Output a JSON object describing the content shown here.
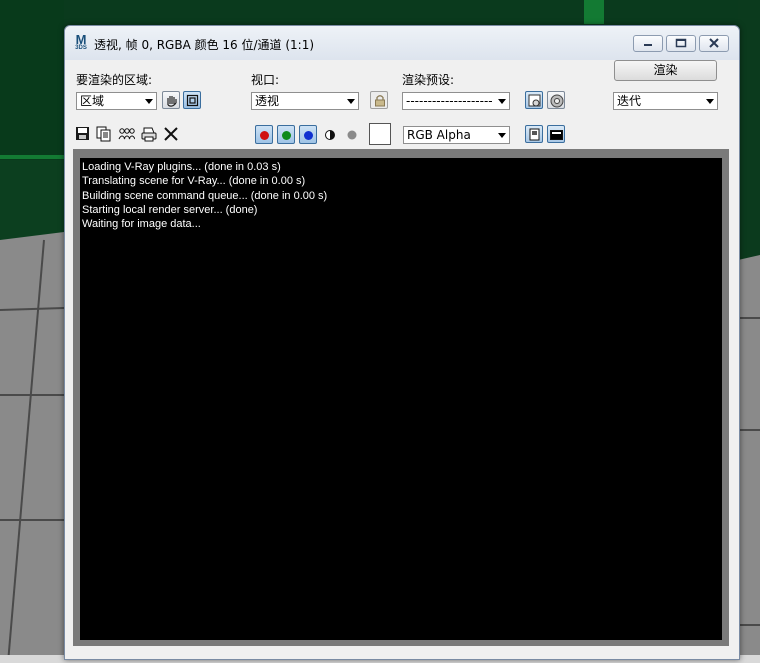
{
  "window": {
    "title": "透视, 帧 0, RGBA 颜色 16 位/通道 (1:1)",
    "logo_text": "M",
    "logo_sub": "3DS"
  },
  "area": {
    "label": "要渲染的区域:",
    "value": "区域"
  },
  "viewport": {
    "label": "视口:",
    "value": "透视"
  },
  "preset": {
    "label": "渲染预设:",
    "value": "--------------------"
  },
  "render": {
    "button_label": "渲染",
    "mode_value": "迭代"
  },
  "toolbar": {
    "display_channel_value": "RGB Alpha"
  },
  "log_lines": [
    "Loading V-Ray plugins... (done in 0.03 s)",
    "Translating scene for V-Ray... (done in 0.00 s)",
    "Building scene command queue... (done in 0.00 s)",
    "Starting local render server... (done)",
    "Waiting for image data..."
  ],
  "colors": {
    "red_channel": "#d01010",
    "green_channel": "#0d8a1a",
    "blue_channel": "#1030d0",
    "render_bg": "#000000",
    "title_text": "#000000"
  }
}
